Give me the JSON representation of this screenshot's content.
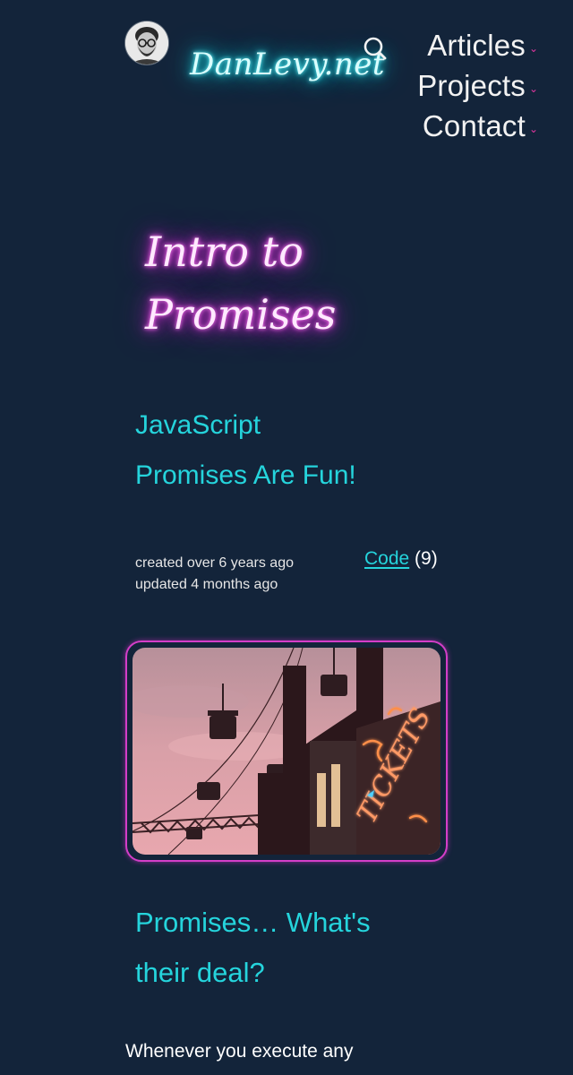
{
  "header": {
    "site_name": "DanLevy.net",
    "nav": [
      {
        "label": "Articles"
      },
      {
        "label": "Projects"
      },
      {
        "label": "Contact"
      }
    ]
  },
  "article": {
    "title_line1": "Intro to",
    "title_line2": "Promises",
    "subtitle_line1": "JavaScript",
    "subtitle_line2": "Promises Are Fun!",
    "created": "created over 6 years ago",
    "updated": "updated 4 months ago",
    "tag_label": "Code",
    "tag_count": "(9)",
    "section_heading_line1": "Promises… What's",
    "section_heading_line2": "their deal?",
    "body_excerpt": "Whenever you execute any"
  },
  "hero_image": {
    "sign_text": "TICKETS",
    "colors": {
      "sky_top": "#caa0a6",
      "sky_bottom": "#e6a0a8",
      "silhouette": "#3a2024",
      "neon_orange": "#ff8f4a",
      "neon_pink": "#ff5a7a",
      "neon_blue": "#4fd0ff"
    }
  },
  "colors": {
    "background": "#13243a",
    "cyan": "#25d4dc",
    "magenta": "#d43ec8",
    "nav_caret": "#e2359f"
  },
  "icons": {
    "avatar": "person-photo",
    "search": "search-icon",
    "caret": "chevron-down-icon"
  }
}
